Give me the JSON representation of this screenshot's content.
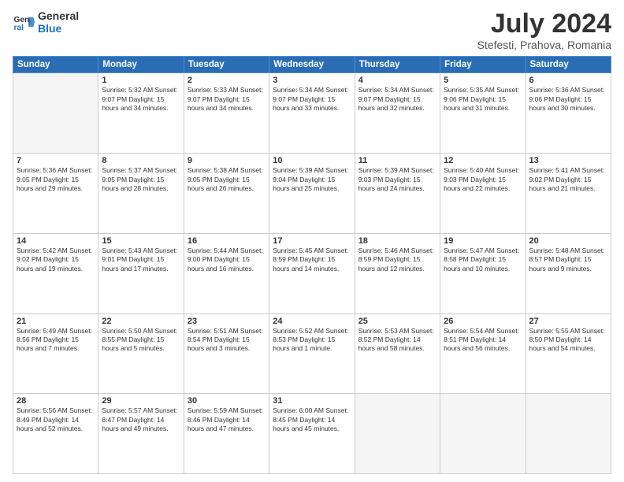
{
  "header": {
    "logo_line1": "General",
    "logo_line2": "Blue",
    "title": "July 2024",
    "subtitle": "Stefesti, Prahova, Romania"
  },
  "days_of_week": [
    "Sunday",
    "Monday",
    "Tuesday",
    "Wednesday",
    "Thursday",
    "Friday",
    "Saturday"
  ],
  "weeks": [
    [
      {
        "day": "",
        "detail": ""
      },
      {
        "day": "1",
        "detail": "Sunrise: 5:32 AM\nSunset: 9:07 PM\nDaylight: 15 hours\nand 34 minutes."
      },
      {
        "day": "2",
        "detail": "Sunrise: 5:33 AM\nSunset: 9:07 PM\nDaylight: 15 hours\nand 34 minutes."
      },
      {
        "day": "3",
        "detail": "Sunrise: 5:34 AM\nSunset: 9:07 PM\nDaylight: 15 hours\nand 33 minutes."
      },
      {
        "day": "4",
        "detail": "Sunrise: 5:34 AM\nSunset: 9:07 PM\nDaylight: 15 hours\nand 32 minutes."
      },
      {
        "day": "5",
        "detail": "Sunrise: 5:35 AM\nSunset: 9:06 PM\nDaylight: 15 hours\nand 31 minutes."
      },
      {
        "day": "6",
        "detail": "Sunrise: 5:36 AM\nSunset: 9:06 PM\nDaylight: 15 hours\nand 30 minutes."
      }
    ],
    [
      {
        "day": "7",
        "detail": "Sunrise: 5:36 AM\nSunset: 9:05 PM\nDaylight: 15 hours\nand 29 minutes."
      },
      {
        "day": "8",
        "detail": "Sunrise: 5:37 AM\nSunset: 9:05 PM\nDaylight: 15 hours\nand 28 minutes."
      },
      {
        "day": "9",
        "detail": "Sunrise: 5:38 AM\nSunset: 9:05 PM\nDaylight: 15 hours\nand 26 minutes."
      },
      {
        "day": "10",
        "detail": "Sunrise: 5:39 AM\nSunset: 9:04 PM\nDaylight: 15 hours\nand 25 minutes."
      },
      {
        "day": "11",
        "detail": "Sunrise: 5:39 AM\nSunset: 9:03 PM\nDaylight: 15 hours\nand 24 minutes."
      },
      {
        "day": "12",
        "detail": "Sunrise: 5:40 AM\nSunset: 9:03 PM\nDaylight: 15 hours\nand 22 minutes."
      },
      {
        "day": "13",
        "detail": "Sunrise: 5:41 AM\nSunset: 9:02 PM\nDaylight: 15 hours\nand 21 minutes."
      }
    ],
    [
      {
        "day": "14",
        "detail": "Sunrise: 5:42 AM\nSunset: 9:02 PM\nDaylight: 15 hours\nand 19 minutes."
      },
      {
        "day": "15",
        "detail": "Sunrise: 5:43 AM\nSunset: 9:01 PM\nDaylight: 15 hours\nand 17 minutes."
      },
      {
        "day": "16",
        "detail": "Sunrise: 5:44 AM\nSunset: 9:00 PM\nDaylight: 15 hours\nand 16 minutes."
      },
      {
        "day": "17",
        "detail": "Sunrise: 5:45 AM\nSunset: 8:59 PM\nDaylight: 15 hours\nand 14 minutes."
      },
      {
        "day": "18",
        "detail": "Sunrise: 5:46 AM\nSunset: 8:59 PM\nDaylight: 15 hours\nand 12 minutes."
      },
      {
        "day": "19",
        "detail": "Sunrise: 5:47 AM\nSunset: 8:58 PM\nDaylight: 15 hours\nand 10 minutes."
      },
      {
        "day": "20",
        "detail": "Sunrise: 5:48 AM\nSunset: 8:57 PM\nDaylight: 15 hours\nand 9 minutes."
      }
    ],
    [
      {
        "day": "21",
        "detail": "Sunrise: 5:49 AM\nSunset: 8:56 PM\nDaylight: 15 hours\nand 7 minutes."
      },
      {
        "day": "22",
        "detail": "Sunrise: 5:50 AM\nSunset: 8:55 PM\nDaylight: 15 hours\nand 5 minutes."
      },
      {
        "day": "23",
        "detail": "Sunrise: 5:51 AM\nSunset: 8:54 PM\nDaylight: 15 hours\nand 3 minutes."
      },
      {
        "day": "24",
        "detail": "Sunrise: 5:52 AM\nSunset: 8:53 PM\nDaylight: 15 hours\nand 1 minute."
      },
      {
        "day": "25",
        "detail": "Sunrise: 5:53 AM\nSunset: 8:52 PM\nDaylight: 14 hours\nand 58 minutes."
      },
      {
        "day": "26",
        "detail": "Sunrise: 5:54 AM\nSunset: 8:51 PM\nDaylight: 14 hours\nand 56 minutes."
      },
      {
        "day": "27",
        "detail": "Sunrise: 5:55 AM\nSunset: 8:50 PM\nDaylight: 14 hours\nand 54 minutes."
      }
    ],
    [
      {
        "day": "28",
        "detail": "Sunrise: 5:56 AM\nSunset: 8:49 PM\nDaylight: 14 hours\nand 52 minutes."
      },
      {
        "day": "29",
        "detail": "Sunrise: 5:57 AM\nSunset: 8:47 PM\nDaylight: 14 hours\nand 49 minutes."
      },
      {
        "day": "30",
        "detail": "Sunrise: 5:59 AM\nSunset: 8:46 PM\nDaylight: 14 hours\nand 47 minutes."
      },
      {
        "day": "31",
        "detail": "Sunrise: 6:00 AM\nSunset: 8:45 PM\nDaylight: 14 hours\nand 45 minutes."
      },
      {
        "day": "",
        "detail": ""
      },
      {
        "day": "",
        "detail": ""
      },
      {
        "day": "",
        "detail": ""
      }
    ]
  ]
}
